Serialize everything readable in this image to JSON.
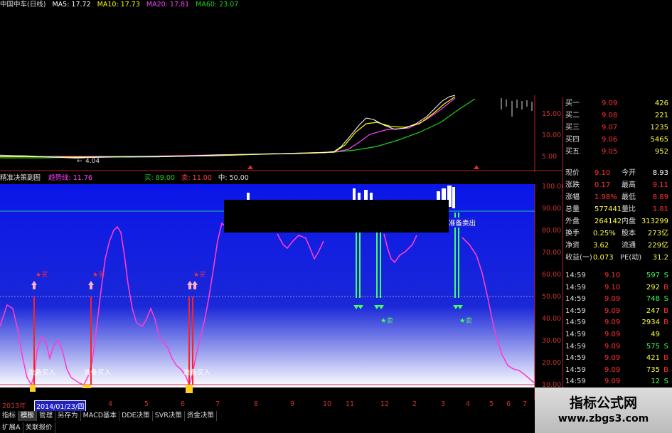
{
  "header": {
    "stock_name": "中国中车(日线)",
    "ma5": "MA5: 17.72",
    "ma10": "MA10: 17.73",
    "ma20": "MA20: 17.81",
    "ma60": "MA60: 23.07",
    "colors": {
      "ma5": "#ffffff",
      "ma10": "#ffff00",
      "ma20": "#ff40ff",
      "ma60": "#20d020"
    }
  },
  "price_axis": [
    "15.00",
    "10.00",
    "5.00"
  ],
  "price_low_label": "4.04",
  "indicator": {
    "name": "精准决策副图",
    "trend_label": "趋势线: 11.76",
    "buy_label": "买: 89.00",
    "sell_label": "卖: 11.00",
    "mid_label": "中: 50.00",
    "axis": [
      "100.00",
      "90.00",
      "80.00",
      "70.00",
      "60.00",
      "50.00",
      "40.00",
      "30.00",
      "20.00",
      "10.00"
    ],
    "buy_prep_text": "准备买入",
    "sell_prep_text": "准备卖出",
    "buy_star": "★买",
    "sell_star": "★卖"
  },
  "quotes": {
    "bids": [
      {
        "label": "买一",
        "price": "9.09",
        "vol": "426"
      },
      {
        "label": "买二",
        "price": "9.08",
        "vol": "221"
      },
      {
        "label": "买三",
        "price": "9.07",
        "vol": "1235"
      },
      {
        "label": "买四",
        "price": "9.06",
        "vol": "5465"
      },
      {
        "label": "买五",
        "price": "9.05",
        "vol": "952"
      }
    ],
    "stats": [
      {
        "l1": "现价",
        "v1": "9.10",
        "l2": "今开",
        "v2": "8.93"
      },
      {
        "l1": "涨跌",
        "v1": "0.17",
        "l2": "最高",
        "v2": "9.11"
      },
      {
        "l1": "涨幅",
        "v1": "1.98%",
        "l2": "最低",
        "v2": "8.89"
      },
      {
        "l1": "总量",
        "v1": "577441",
        "l2": "量比",
        "v2": "1.81"
      },
      {
        "l1": "外盘",
        "v1": "264142",
        "l2": "内盘",
        "v2": "313299"
      },
      {
        "l1": "换手",
        "v1": "0.25%",
        "l2": "股本",
        "v2": "273亿"
      },
      {
        "l1": "净资",
        "v1": "3.62",
        "l2": "流通",
        "v2": "229亿"
      },
      {
        "l1": "收益(一)",
        "v1": "0.073",
        "l2": "PE(动)",
        "v2": "31.2"
      }
    ],
    "ticks": [
      {
        "time": "14:59",
        "price": "9.10",
        "vol": "597",
        "side": "S"
      },
      {
        "time": "14:59",
        "price": "9.10",
        "vol": "292",
        "side": "B"
      },
      {
        "time": "14:59",
        "price": "9.09",
        "vol": "748",
        "side": "S"
      },
      {
        "time": "14:59",
        "price": "9.09",
        "vol": "247",
        "side": "B"
      },
      {
        "time": "14:59",
        "price": "9.09",
        "vol": "2934",
        "side": "B"
      },
      {
        "time": "14:59",
        "price": "9.09",
        "vol": "49",
        "side": ""
      },
      {
        "time": "14:59",
        "price": "9.09",
        "vol": "575",
        "side": "S"
      },
      {
        "time": "14:59",
        "price": "9.09",
        "vol": "421",
        "side": "B"
      },
      {
        "time": "14:59",
        "price": "9.09",
        "vol": "735",
        "side": "B"
      },
      {
        "time": "14:59",
        "price": "9.09",
        "vol": "12",
        "side": "S"
      }
    ]
  },
  "time_axis": {
    "start": "2013年",
    "cursor_date": "2014/01/23/四",
    "months": [
      "4",
      "5",
      "6",
      "7",
      "8",
      "9",
      "10",
      "11",
      "12",
      "2",
      "3",
      "4",
      "5",
      "6",
      "7"
    ]
  },
  "tabs": [
    "指标",
    "模板",
    "管理",
    "另存为",
    "MACD基本",
    "DDE决策",
    "SVR决策",
    "资金决策"
  ],
  "tabs2": [
    "扩展A",
    "关联报价"
  ],
  "watermark": {
    "title": "指标公式网",
    "url": "www.zbgs3.com"
  }
}
